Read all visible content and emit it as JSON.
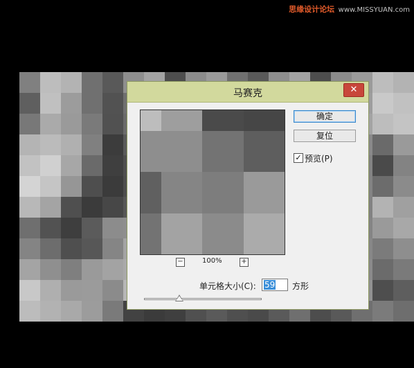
{
  "watermark": {
    "site_cn": "思缘设计论坛",
    "site_url": "www.MISSYUAN.com"
  },
  "canvas": {
    "tile_grays": [
      "#808080",
      "#bdbdbd",
      "#b3b3b3",
      "#707070",
      "#595959",
      "#8e8e8e",
      "#a3a3a3",
      "#4d4d4d",
      "#8b8b8b",
      "#9a9a9a",
      "#707070",
      "#595959",
      "#8e8e8e",
      "#a3a3a3",
      "#4d4d4d",
      "#8b8b8b",
      "#9a9a9a",
      "#bdbdbd",
      "#b3b3b3",
      "#5f5f5f",
      "#c0c0c0",
      "#9c9c9c",
      "#707070",
      "#525252",
      "#6f6f6f",
      "#9b9b9b",
      "#585858",
      "#7a7a7a",
      "#8f8f8f",
      "#6b6b6b",
      "#565656",
      "#7a7a7a",
      "#9a9a9a",
      "#4f4f4f",
      "#888888",
      "#9d9d9d",
      "#c9c9c9",
      "#c1c1c1",
      "#787878",
      "#aaaaaa",
      "#9a9a9a",
      "#7a7a7a",
      "#515151",
      "#6a6a6a",
      "#a4a4a4",
      "#6d6d6d",
      "#7b7b7b",
      "#929292",
      "#6f6f6f",
      "#5a5a5a",
      "#808080",
      "#a1a1a1",
      "#5a5a5a",
      "#808080",
      "#a3a3a3",
      "#bdbdbd",
      "#c4c4c4",
      "#b4b4b4",
      "#bbbbbb",
      "#b0b0b0",
      "#808080",
      "#3c3c3c",
      "#595959",
      "#8a8a8a",
      "#666666",
      "#707070",
      "#8c8c8c",
      "#666666",
      "#525252",
      "#707070",
      "#999999",
      "#5b5b5b",
      "#747474",
      "#898989",
      "#6a6a6a",
      "#9a9a9a",
      "#c2c2c2",
      "#d0d0d0",
      "#a7a7a7",
      "#6a6a6a",
      "#3f3f3f",
      "#4e4e4e",
      "#7f7f7f",
      "#676767",
      "#6e6e6e",
      "#8a8a8a",
      "#666666",
      "#565656",
      "#6d6d6d",
      "#979797",
      "#595959",
      "#6e6e6e",
      "#838383",
      "#4a4a4a",
      "#838383",
      "#d4d4d4",
      "#c5c5c5",
      "#969696",
      "#4e4e4e",
      "#3b3b3b",
      "#4d4d4d",
      "#7b7b7b",
      "#636363",
      "#6c6c6c",
      "#8a8a8a",
      "#646464",
      "#565656",
      "#6b6b6b",
      "#959595",
      "#575757",
      "#6c6c6c",
      "#838383",
      "#6c6c6c",
      "#8b8b8b",
      "#b8b8b8",
      "#a4a4a4",
      "#4f4f4f",
      "#3b3b3b",
      "#474747",
      "#565656",
      "#7a7a7a",
      "#636363",
      "#6b6b6b",
      "#878787",
      "#636363",
      "#575757",
      "#6b6b6b",
      "#939393",
      "#585858",
      "#6b6b6b",
      "#828282",
      "#b3b3b3",
      "#a0a0a0",
      "#6f6f6f",
      "#525252",
      "#3e3e3e",
      "#5b5b5b",
      "#8c8c8c",
      "#8e8e8e",
      "#7d7d7d",
      "#6a6a6a",
      "#707070",
      "#868686",
      "#656565",
      "#5a5a5a",
      "#6e6e6e",
      "#929292",
      "#5a5a5a",
      "#6e6e6e",
      "#848484",
      "#9a9a9a",
      "#a8a8a8",
      "#848484",
      "#6d6d6d",
      "#4f4f4f",
      "#575757",
      "#858585",
      "#a3a3a3",
      "#8a8a8a",
      "#6d6d6d",
      "#707070",
      "#888888",
      "#666666",
      "#5b5b5b",
      "#707070",
      "#959595",
      "#5c5c5c",
      "#6f6f6f",
      "#878787",
      "#7b7b7b",
      "#8e8e8e",
      "#a4a4a4",
      "#8f8f8f",
      "#7f7f7f",
      "#9a9a9a",
      "#a3a3a3",
      "#a9a9a9",
      "#8f8f8f",
      "#727272",
      "#737373",
      "#8b8b8b",
      "#6a6a6a",
      "#5e5e5e",
      "#727272",
      "#989898",
      "#5f5f5f",
      "#727272",
      "#8a8a8a",
      "#6b6b6b",
      "#7a7a7a",
      "#c8c8c8",
      "#afafaf",
      "#9a9a9a",
      "#9b9b9b",
      "#8b8b8b",
      "#b6b6b6",
      "#989898",
      "#7a7a7a",
      "#787878",
      "#8f8f8f",
      "#6f6f6f",
      "#636363",
      "#777777",
      "#9d9d9d",
      "#656565",
      "#787878",
      "#919191",
      "#4e4e4e",
      "#5e5e5e",
      "#bcbcbc",
      "#b2b2b2",
      "#a9a9a9",
      "#9c9c9c",
      "#7a7a7a",
      "#424242",
      "#3b3b3b",
      "#3f3f3f",
      "#505050",
      "#5a5a5a",
      "#4f4f4f",
      "#4a4a4a",
      "#5a5a5a",
      "#6f6f6f",
      "#4d4d4d",
      "#595959",
      "#6f6f6f",
      "#7b7b7b",
      "#6e6e6e"
    ]
  },
  "dialog": {
    "title": "马赛克",
    "close_glyph": "✕",
    "ok_label": "确定",
    "reset_label": "复位",
    "preview_label": "预览(P)",
    "preview_checked": true,
    "zoom_minus": "−",
    "zoom_plus": "+",
    "zoom_level": "100%",
    "cell_size_label": "单元格大小(C):",
    "cell_size_value": "59",
    "cell_size_unit": "方形",
    "slider_fraction": 0.3
  },
  "preview_tiles": [
    {
      "col": 0,
      "row": 0,
      "w": 1,
      "h": 1,
      "gray": "#bdbdbd"
    },
    {
      "col": 1,
      "row": 0,
      "w": 2,
      "h": 1,
      "gray": "#9e9e9e"
    },
    {
      "col": 3,
      "row": 0,
      "w": 2,
      "h": 1,
      "gray": "#4a4a4a"
    },
    {
      "col": 5,
      "row": 0,
      "w": 2,
      "h": 1,
      "gray": "#464646"
    },
    {
      "col": 0,
      "row": 1,
      "w": 3,
      "h": 2,
      "gray": "#8e8e8e"
    },
    {
      "col": 3,
      "row": 1,
      "w": 2,
      "h": 2,
      "gray": "#737373"
    },
    {
      "col": 5,
      "row": 1,
      "w": 2,
      "h": 2,
      "gray": "#5e5e5e"
    },
    {
      "col": 0,
      "row": 3,
      "w": 1,
      "h": 2,
      "gray": "#606060"
    },
    {
      "col": 1,
      "row": 3,
      "w": 2,
      "h": 2,
      "gray": "#858585"
    },
    {
      "col": 3,
      "row": 3,
      "w": 2,
      "h": 2,
      "gray": "#7d7d7d"
    },
    {
      "col": 5,
      "row": 3,
      "w": 2,
      "h": 2,
      "gray": "#9a9a9a"
    },
    {
      "col": 0,
      "row": 5,
      "w": 1,
      "h": 2,
      "gray": "#737373"
    },
    {
      "col": 1,
      "row": 5,
      "w": 2,
      "h": 2,
      "gray": "#a3a3a3"
    },
    {
      "col": 3,
      "row": 5,
      "w": 2,
      "h": 2,
      "gray": "#8b8b8b"
    },
    {
      "col": 5,
      "row": 5,
      "w": 2,
      "h": 2,
      "gray": "#ababab"
    }
  ]
}
